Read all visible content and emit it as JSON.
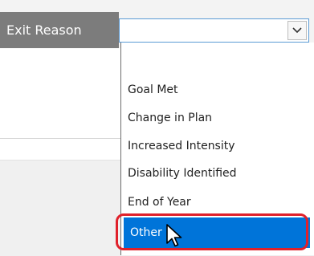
{
  "form": {
    "field_label": "Exit Reason",
    "select_value": ""
  },
  "dropdown": {
    "options": [
      {
        "label": ""
      },
      {
        "label": "Goal Met"
      },
      {
        "label": "Change in Plan"
      },
      {
        "label": "Increased Intensity"
      },
      {
        "label": "Disability Identified"
      },
      {
        "label": "End of Year"
      },
      {
        "label": "Other"
      }
    ],
    "selected_index": 6
  },
  "colors": {
    "label_background": "#7c7c7c",
    "select_border": "#5b9bd5",
    "selected_background": "#0074d9",
    "highlight_ring": "#e0212b"
  },
  "icons": {
    "select_arrow": "chevron-down-icon",
    "cursor": "mouse-pointer-icon"
  }
}
